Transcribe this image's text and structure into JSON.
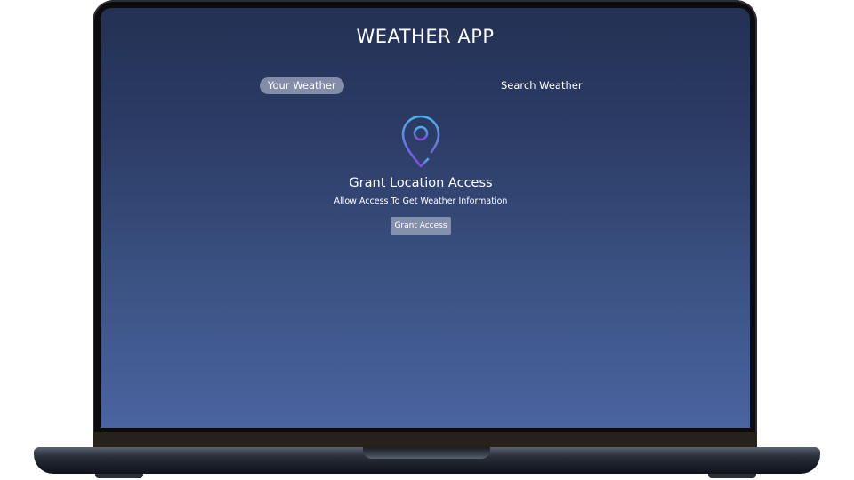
{
  "app": {
    "title": "WEATHER APP"
  },
  "tabs": [
    {
      "label": "Your Weather",
      "active": true
    },
    {
      "label": "Search Weather",
      "active": false
    }
  ],
  "grant": {
    "icon": "location-pin-icon",
    "heading": "Grant Location Access",
    "subtext": "Allow Access To Get Weather Information",
    "button_label": "Grant Access"
  },
  "colors": {
    "background_top": "#233154",
    "background_bottom": "#4a64a0",
    "pin_gradient_start": "#4fb0e8",
    "pin_gradient_end": "#7b4ad8"
  }
}
